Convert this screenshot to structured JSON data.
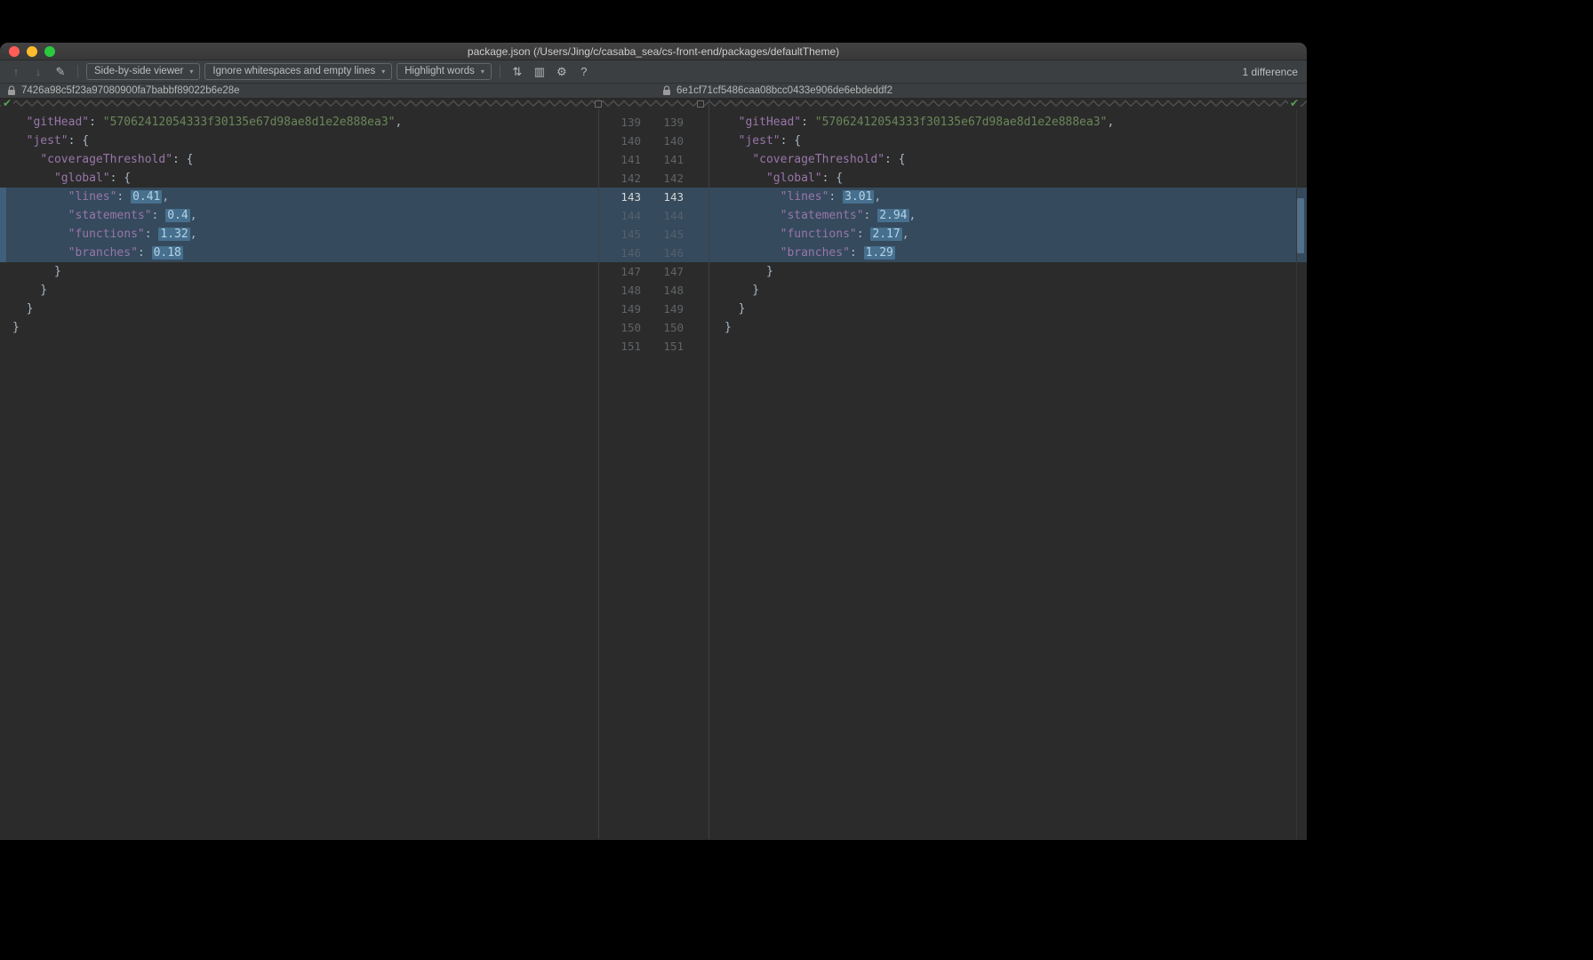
{
  "window": {
    "title": "package.json (/Users/Jing/c/casaba_sea/cs-front-end/packages/defaultTheme)"
  },
  "toolbar": {
    "viewer_dropdown": "Side-by-side viewer",
    "whitespace_dropdown": "Ignore whitespaces and empty lines",
    "highlight_dropdown": "Highlight words",
    "difference_count": "1 difference"
  },
  "icons": {
    "prev": "↑",
    "next": "↓",
    "edit": "✎",
    "sync_scroll": "⇅",
    "columns": "▥",
    "settings": "⚙",
    "help": "?",
    "dropdown_arrow": "▾",
    "check": "✔"
  },
  "revisions": {
    "left_hash": "7426a98c5f23a97080900fa7babbf89022b6e28e",
    "right_hash": "6e1cf71cf5486caa08bcc0433e906de6ebdeddf2"
  },
  "colors": {
    "editor_bg": "#2b2b2b",
    "key": "#9876aa",
    "string": "#6a8759",
    "number": "#6897bb",
    "punctuation": "#a9b7c6",
    "changed_line_bg": "#354a5c",
    "changed_word_bg": "#46708e",
    "identical_check_green": "#55a254"
  },
  "diff": {
    "lines": [
      {
        "nl": "139",
        "nr": "139",
        "changed": false,
        "caret": false,
        "left": [
          [
            "ind",
            "  "
          ],
          [
            "key",
            "\"gitHead\""
          ],
          [
            "punc",
            ": "
          ],
          [
            "str",
            "\"57062412054333f30135e67d98ae8d1e2e888ea3\""
          ],
          [
            "punc",
            ","
          ]
        ],
        "right": [
          [
            "ind",
            "  "
          ],
          [
            "key",
            "\"gitHead\""
          ],
          [
            "punc",
            ": "
          ],
          [
            "str",
            "\"57062412054333f30135e67d98ae8d1e2e888ea3\""
          ],
          [
            "punc",
            ","
          ]
        ]
      },
      {
        "nl": "140",
        "nr": "140",
        "changed": false,
        "caret": false,
        "left": [
          [
            "ind",
            "  "
          ],
          [
            "key",
            "\"jest\""
          ],
          [
            "punc",
            ": {"
          ]
        ],
        "right": [
          [
            "ind",
            "  "
          ],
          [
            "key",
            "\"jest\""
          ],
          [
            "punc",
            ": {"
          ]
        ]
      },
      {
        "nl": "141",
        "nr": "141",
        "changed": false,
        "caret": false,
        "left": [
          [
            "ind",
            "    "
          ],
          [
            "key",
            "\"coverageThreshold\""
          ],
          [
            "punc",
            ": {"
          ]
        ],
        "right": [
          [
            "ind",
            "    "
          ],
          [
            "key",
            "\"coverageThreshold\""
          ],
          [
            "punc",
            ": {"
          ]
        ]
      },
      {
        "nl": "142",
        "nr": "142",
        "changed": false,
        "caret": false,
        "left": [
          [
            "ind",
            "      "
          ],
          [
            "key",
            "\"global\""
          ],
          [
            "punc",
            ": {"
          ]
        ],
        "right": [
          [
            "ind",
            "      "
          ],
          [
            "key",
            "\"global\""
          ],
          [
            "punc",
            ": {"
          ]
        ]
      },
      {
        "nl": "143",
        "nr": "143",
        "changed": true,
        "caret": true,
        "left": [
          [
            "ind",
            "        "
          ],
          [
            "key",
            "\"lines\""
          ],
          [
            "punc",
            ": "
          ],
          [
            "num",
            "0.41",
            1
          ],
          [
            "punc",
            ","
          ]
        ],
        "right": [
          [
            "ind",
            "        "
          ],
          [
            "key",
            "\"lines\""
          ],
          [
            "punc",
            ": "
          ],
          [
            "num",
            "3.01",
            1
          ],
          [
            "punc",
            ","
          ]
        ]
      },
      {
        "nl": "144",
        "nr": "144",
        "changed": true,
        "caret": false,
        "left": [
          [
            "ind",
            "        "
          ],
          [
            "key",
            "\"statements\""
          ],
          [
            "punc",
            ": "
          ],
          [
            "num",
            "0.4",
            1
          ],
          [
            "punc",
            ","
          ]
        ],
        "right": [
          [
            "ind",
            "        "
          ],
          [
            "key",
            "\"statements\""
          ],
          [
            "punc",
            ": "
          ],
          [
            "num",
            "2.94",
            1
          ],
          [
            "punc",
            ","
          ]
        ]
      },
      {
        "nl": "145",
        "nr": "145",
        "changed": true,
        "caret": false,
        "left": [
          [
            "ind",
            "        "
          ],
          [
            "key",
            "\"functions\""
          ],
          [
            "punc",
            ": "
          ],
          [
            "num",
            "1.32",
            1
          ],
          [
            "punc",
            ","
          ]
        ],
        "right": [
          [
            "ind",
            "        "
          ],
          [
            "key",
            "\"functions\""
          ],
          [
            "punc",
            ": "
          ],
          [
            "num",
            "2.17",
            1
          ],
          [
            "punc",
            ","
          ]
        ]
      },
      {
        "nl": "146",
        "nr": "146",
        "changed": true,
        "caret": false,
        "left": [
          [
            "ind",
            "        "
          ],
          [
            "key",
            "\"branches\""
          ],
          [
            "punc",
            ": "
          ],
          [
            "num",
            "0.18",
            1
          ]
        ],
        "right": [
          [
            "ind",
            "        "
          ],
          [
            "key",
            "\"branches\""
          ],
          [
            "punc",
            ": "
          ],
          [
            "num",
            "1.29",
            1
          ]
        ]
      },
      {
        "nl": "147",
        "nr": "147",
        "changed": false,
        "caret": false,
        "left": [
          [
            "punc",
            "      }"
          ]
        ],
        "right": [
          [
            "punc",
            "      }"
          ]
        ]
      },
      {
        "nl": "148",
        "nr": "148",
        "changed": false,
        "caret": false,
        "left": [
          [
            "punc",
            "    }"
          ]
        ],
        "right": [
          [
            "punc",
            "    }"
          ]
        ]
      },
      {
        "nl": "149",
        "nr": "149",
        "changed": false,
        "caret": false,
        "left": [
          [
            "punc",
            "  }"
          ]
        ],
        "right": [
          [
            "punc",
            "  }"
          ]
        ]
      },
      {
        "nl": "150",
        "nr": "150",
        "changed": false,
        "caret": false,
        "left": [
          [
            "punc",
            "}"
          ]
        ],
        "right": [
          [
            "punc",
            "}"
          ]
        ]
      },
      {
        "nl": "151",
        "nr": "151",
        "changed": false,
        "caret": false,
        "left": [],
        "right": []
      }
    ]
  }
}
